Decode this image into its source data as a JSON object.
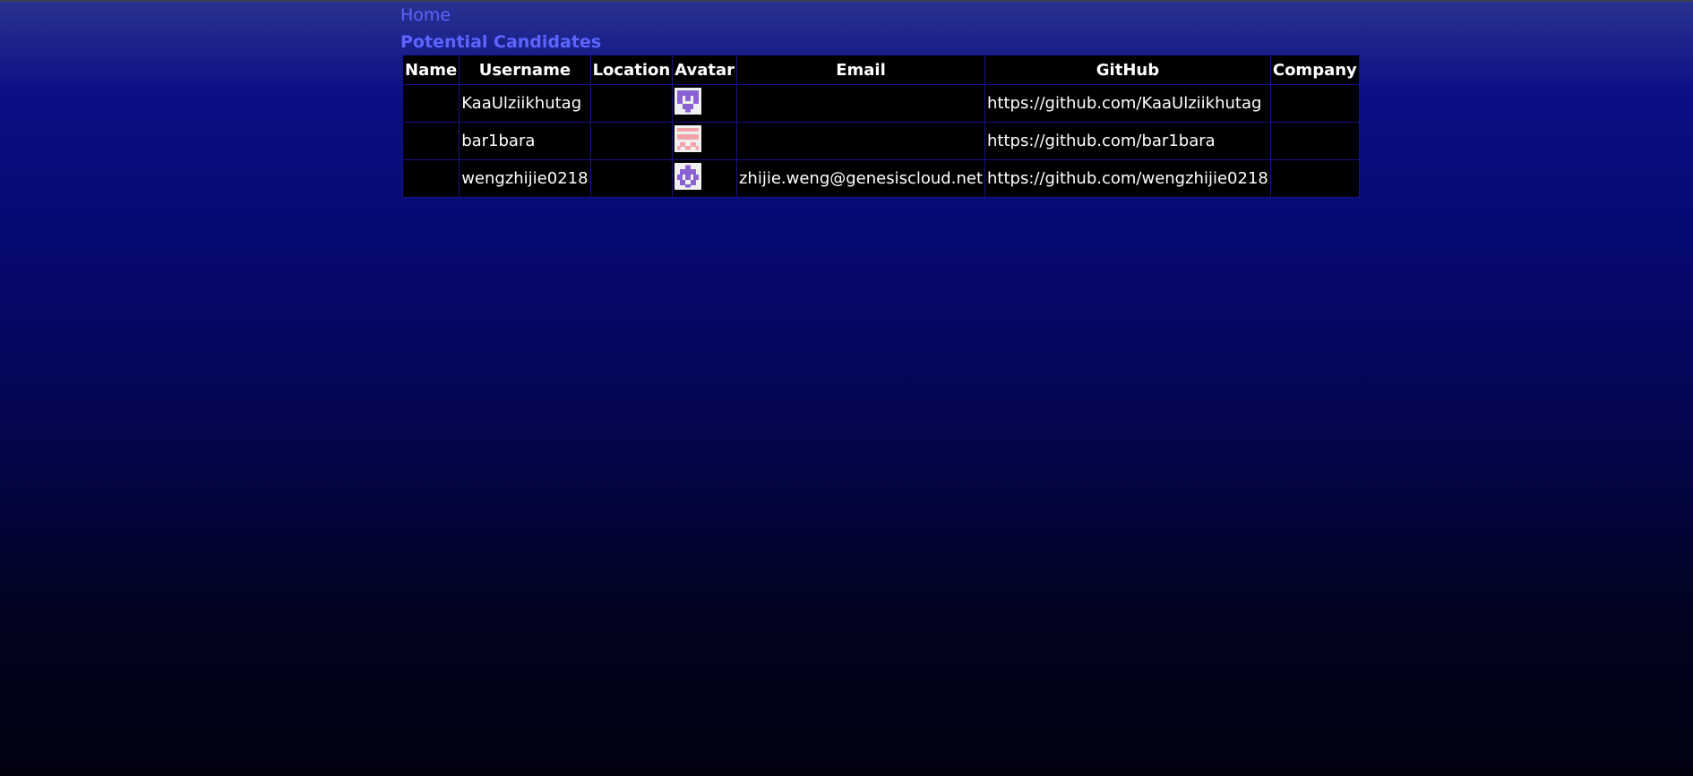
{
  "nav": {
    "home_label": "Home"
  },
  "page": {
    "title": "Potential Candidates"
  },
  "table": {
    "headers": [
      "Name",
      "Username",
      "Location",
      "Avatar",
      "Email",
      "GitHub",
      "Company"
    ],
    "rows": [
      {
        "name": "",
        "username": "KaaUlziikhutag",
        "location": "",
        "avatar": "identicon-purple-1",
        "email": "",
        "github": "https://github.com/KaaUlziikhutag",
        "company": ""
      },
      {
        "name": "",
        "username": "bar1bara",
        "location": "",
        "avatar": "identicon-pink",
        "email": "",
        "github": "https://github.com/bar1bara",
        "company": ""
      },
      {
        "name": "",
        "username": "wengzhijie0218",
        "location": "",
        "avatar": "identicon-purple-2",
        "email": "zhijie.weng@genesiscloud.net",
        "github": "https://github.com/wengzhijie0218",
        "company": ""
      }
    ]
  },
  "colors": {
    "link": "#5d64ff",
    "table_border": "#15138a",
    "avatar_purple": "#8a63d2",
    "avatar_pink": "#f0a3a8"
  }
}
